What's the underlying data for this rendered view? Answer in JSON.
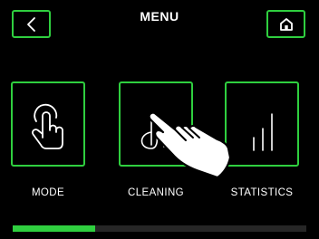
{
  "header": {
    "title": "MENU",
    "back_icon": "chevron-left-icon",
    "home_icon": "home-icon"
  },
  "menu": {
    "items": [
      {
        "label": "MODE",
        "icon": "touch-hand-icon"
      },
      {
        "label": "CLEANING",
        "icon": "cleaning-icon"
      },
      {
        "label": "STATISTICS",
        "icon": "statistics-icon"
      }
    ]
  },
  "progress": {
    "value": 0.28
  },
  "colors": {
    "accent": "#2fcf3f",
    "background": "#000000",
    "track": "#262626"
  }
}
